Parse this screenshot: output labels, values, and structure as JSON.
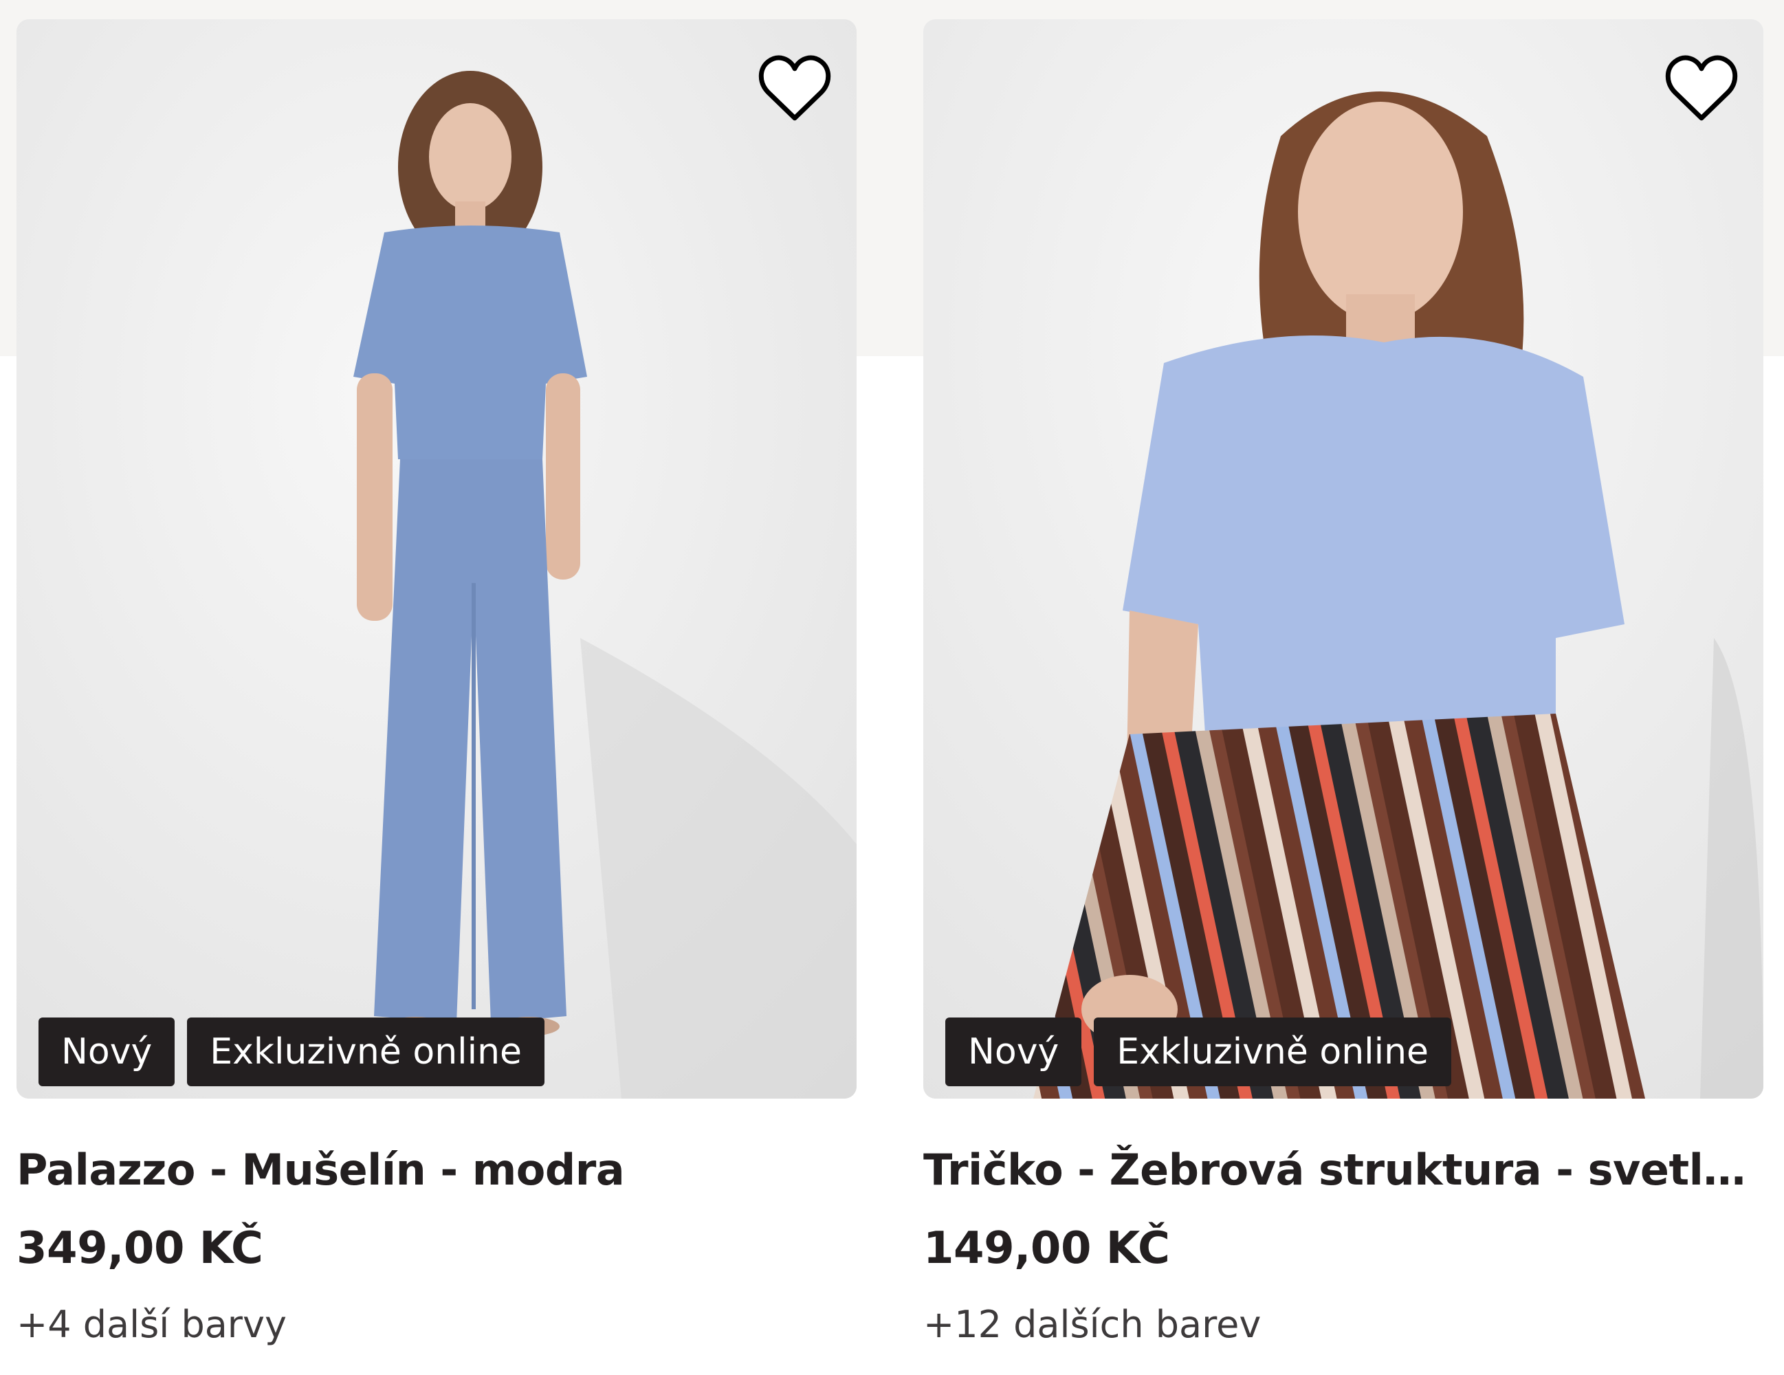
{
  "products": [
    {
      "badges": [
        "Nový",
        "Exkluzivně online"
      ],
      "title": "Palazzo - Mušelín - modra",
      "price": "349,00 KČ",
      "colors": "+4 další barvy"
    },
    {
      "badges": [
        "Nový",
        "Exkluzivně online"
      ],
      "title": "Tričko - Žebrová struktura - svetle mo...",
      "price": "149,00 KČ",
      "colors": "+12 dalších barev"
    }
  ],
  "icons": {
    "favorite": "heart-outline-icon"
  }
}
